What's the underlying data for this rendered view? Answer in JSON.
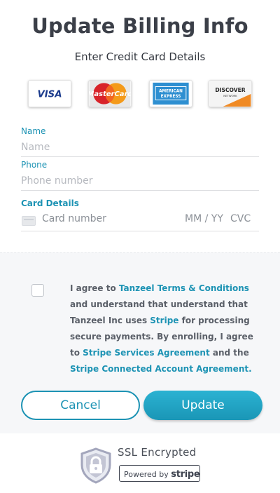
{
  "header": {
    "title": "Update Billing Info",
    "subtitle": "Enter Credit Card Details"
  },
  "card_logos": [
    {
      "name": "visa-logo",
      "text": "VISA"
    },
    {
      "name": "mastercard-logo",
      "text": "MasterCard"
    },
    {
      "name": "amex-logo",
      "text": "AMERICAN EXPRESS"
    },
    {
      "name": "discover-logo",
      "text": "DISCOVER NETWORK"
    }
  ],
  "form": {
    "name_label": "Name",
    "name_placeholder": "Name",
    "name_value": "",
    "phone_label": "Phone",
    "phone_placeholder": "Phone number",
    "phone_value": "",
    "card_label": "Card Details",
    "card_number_placeholder": "Card number",
    "card_expiry_placeholder": "MM / YY",
    "card_cvc_placeholder": "CVC"
  },
  "terms": {
    "checked": false,
    "t1": "I agree to ",
    "link1": "Tanzeel Terms & Conditions",
    "t2": " and understand that understand that Tanzeel Inc uses ",
    "link2": "Stripe",
    "t3": " for processing secure payments. By enrolling, I agree to ",
    "link3": "Stripe Services Agreement",
    "t4": " and the ",
    "link4": "Stripe Connected Account Agreement."
  },
  "buttons": {
    "cancel": "Cancel",
    "update": "Update"
  },
  "footer": {
    "ssl_text": "SSL Encrypted",
    "powered_by": "Powered by ",
    "stripe": "stripe"
  },
  "colors": {
    "accent": "#1d93b4",
    "title": "#3b3f48"
  },
  "icons": {
    "ssl": "shield-lock-icon",
    "card": "credit-card-icon"
  }
}
